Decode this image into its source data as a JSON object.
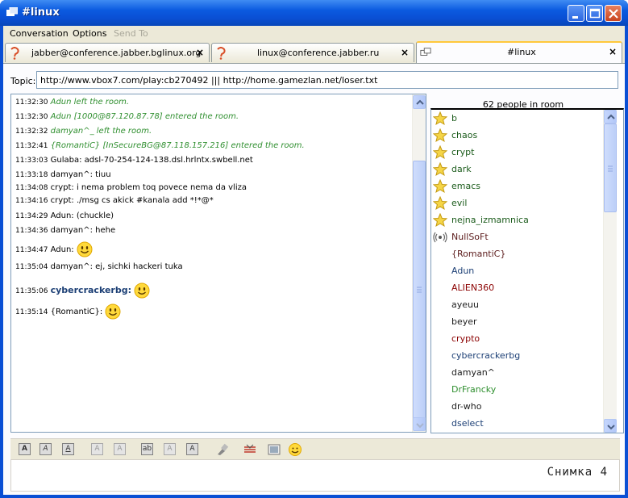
{
  "window": {
    "title": "#linux"
  },
  "menu": {
    "conversation": "Conversation",
    "options": "Options",
    "send_to": "Send To"
  },
  "tabs": [
    {
      "label": "jabber@conference.jabber.bglinux.org",
      "close": "×"
    },
    {
      "label": "linux@conference.jabber.ru",
      "close": "×"
    },
    {
      "label": "#linux",
      "close": "×"
    }
  ],
  "topic": {
    "label": "Topic:",
    "value": "http://www.vbox7.com/play:cb270492 ||| http://home.gamezlan.net/loser.txt"
  },
  "chat": [
    {
      "ts": "11:32:30",
      "text": "Adun left the room.",
      "kind": "system"
    },
    {
      "ts": "11:32:30",
      "text": "Adun [1000@87.120.87.78] entered the room.",
      "kind": "system"
    },
    {
      "ts": "11:32:32",
      "text": "damyan^_ left the room.",
      "kind": "system"
    },
    {
      "ts": "11:32:41",
      "text": "{RomantiC} [InSecureBG@87.118.157.216] entered the room.",
      "kind": "system"
    },
    {
      "ts": "11:33:03",
      "nick": "Gulaba:",
      "text": "adsl-70-254-124-138.dsl.hrlntx.swbell.net",
      "kind": "msg"
    },
    {
      "ts": "11:33:18",
      "nick": "damyan^:",
      "text": "tiuu",
      "kind": "msg"
    },
    {
      "ts": "11:34:08",
      "nick": "crypt:",
      "text": "i nema problem toq povece nema da vliza",
      "kind": "msg"
    },
    {
      "ts": "11:34:16",
      "nick": "crypt:",
      "text": "./msg cs akick #kanala add *!*@*",
      "kind": "msg"
    },
    {
      "ts": "11:34:29",
      "nick": "Adun:",
      "text": "(chuckle)",
      "kind": "msg"
    },
    {
      "ts": "11:34:36",
      "nick": "damyan^:",
      "text": "hehe",
      "kind": "msg"
    },
    {
      "ts": "11:34:47",
      "nick": "Adun:",
      "text": "",
      "kind": "smiley"
    },
    {
      "ts": "11:35:04",
      "nick": "damyan^:",
      "text": "ej,  sichki hackeri tuka",
      "kind": "msg"
    },
    {
      "ts": "11:35:06",
      "nick": "cybercrackerbg:",
      "text": "",
      "kind": "own-smiley"
    },
    {
      "ts": "11:35:14",
      "nick": "{RomantiC}:",
      "text": "",
      "kind": "smiley"
    }
  ],
  "roster": {
    "header": "62 people in room",
    "members": [
      {
        "name": "b",
        "role": "owner",
        "color": "#1c5c1c"
      },
      {
        "name": "chaos",
        "role": "owner",
        "color": "#1c5c1c"
      },
      {
        "name": "crypt",
        "role": "owner",
        "color": "#1c5c1c"
      },
      {
        "name": "dark",
        "role": "owner",
        "color": "#1c5c1c"
      },
      {
        "name": "emacs",
        "role": "owner",
        "color": "#1c5c1c"
      },
      {
        "name": "evil",
        "role": "owner",
        "color": "#1c5c1c"
      },
      {
        "name": "nejna_izmamnica",
        "role": "owner",
        "color": "#1c5c1c"
      },
      {
        "name": "NullSoFt",
        "role": "voice",
        "color": "#5c1c1c"
      },
      {
        "name": "{RomantiC}",
        "role": "none",
        "color": "#5c1c1c"
      },
      {
        "name": "Adun",
        "role": "none",
        "color": "#1c3f75"
      },
      {
        "name": "ALIEN360",
        "role": "none",
        "color": "#8b0000"
      },
      {
        "name": "ayeuu",
        "role": "none",
        "color": "#1c1c1c"
      },
      {
        "name": "beyer",
        "role": "none",
        "color": "#1c1c1c"
      },
      {
        "name": "crypto",
        "role": "none",
        "color": "#8b0000"
      },
      {
        "name": "cybercrackerbg",
        "role": "none",
        "color": "#1c3f75"
      },
      {
        "name": "damyan^",
        "role": "none",
        "color": "#1c1c1c"
      },
      {
        "name": "DrFrancky",
        "role": "none",
        "color": "#2f8f2f"
      },
      {
        "name": "dr-who",
        "role": "none",
        "color": "#1c1c1c"
      },
      {
        "name": "dselect",
        "role": "none",
        "color": "#1c3f75"
      }
    ]
  },
  "format_toolbar": [
    {
      "glyph": "A",
      "icon": "bold-icon"
    },
    {
      "glyph": "A",
      "icon": "italic-icon"
    },
    {
      "glyph": "A",
      "icon": "underline-icon"
    },
    {
      "glyph": "A",
      "icon": "decrease-size-icon"
    },
    {
      "glyph": "A",
      "icon": "normal-size-icon"
    },
    {
      "glyph": "ab",
      "icon": "font-face-icon"
    },
    {
      "glyph": "A",
      "icon": "foreground-color-icon"
    },
    {
      "glyph": "A",
      "icon": "background-color-icon"
    },
    {
      "glyph": "",
      "icon": "clear-formatting-icon"
    },
    {
      "glyph": "",
      "icon": "insert-link-icon"
    },
    {
      "glyph": "",
      "icon": "insert-image-icon"
    },
    {
      "glyph": "",
      "icon": "insert-smiley-icon"
    }
  ],
  "input": {
    "caption": "Снимка 4"
  }
}
